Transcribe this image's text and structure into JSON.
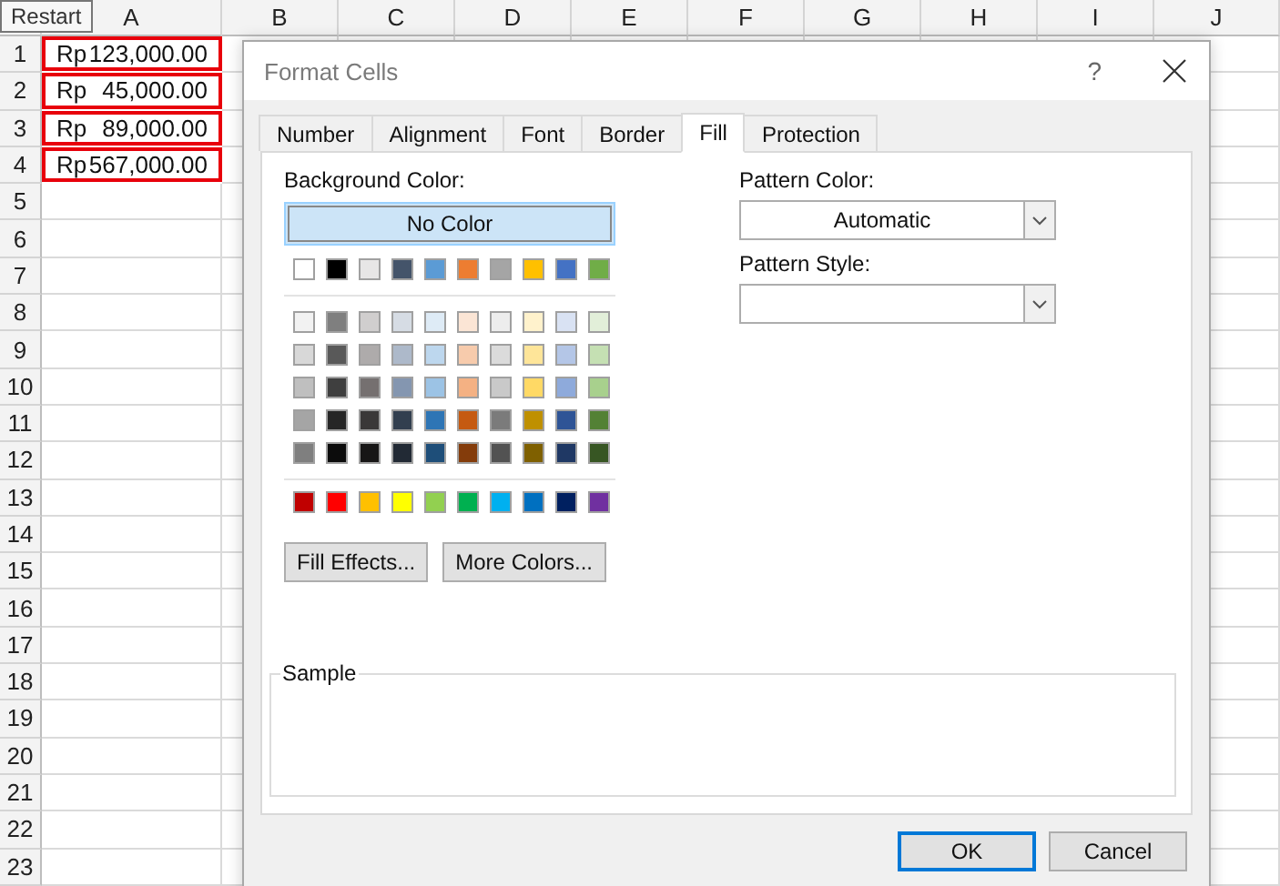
{
  "sheet": {
    "tooltip": "Restart",
    "columns": [
      "A",
      "B",
      "C",
      "D",
      "E",
      "F",
      "G",
      "H",
      "I",
      "J"
    ],
    "row_numbers": [
      "1",
      "2",
      "3",
      "4",
      "5",
      "6",
      "7",
      "8",
      "9",
      "10",
      "11",
      "12",
      "13",
      "14",
      "15",
      "16",
      "17",
      "18",
      "19",
      "20",
      "21",
      "22",
      "23"
    ],
    "cells": [
      {
        "currency": "Rp",
        "amount": "123,000.00",
        "outlined": true
      },
      {
        "currency": "Rp",
        "amount": "45,000.00",
        "outlined": true
      },
      {
        "currency": "Rp",
        "amount": "89,000.00",
        "outlined": true
      },
      {
        "currency": "Rp",
        "amount": "567,000.00",
        "outlined": true
      }
    ]
  },
  "dialog": {
    "title": "Format Cells",
    "help": "?",
    "tabs": [
      {
        "label": "Number",
        "selected": false
      },
      {
        "label": "Alignment",
        "selected": false
      },
      {
        "label": "Font",
        "selected": false
      },
      {
        "label": "Border",
        "selected": false
      },
      {
        "label": "Fill",
        "selected": true
      },
      {
        "label": "Protection",
        "selected": false
      }
    ],
    "background_color": {
      "label": "Background Color:",
      "no_color": {
        "label": "No Color",
        "selected": true
      },
      "theme_colors": [
        {
          "color": "#ffffff"
        },
        {
          "color": "#000000"
        },
        {
          "color": "#e7e6e6"
        },
        {
          "color": "#44546a"
        },
        {
          "color": "#5b9bd5"
        },
        {
          "color": "#ed7d31"
        },
        {
          "color": "#a5a5a5"
        },
        {
          "color": "#ffc000"
        },
        {
          "color": "#4472c4"
        },
        {
          "color": "#70ad47"
        }
      ],
      "tint_rows": [
        {
          "swatches": [
            {
              "color": "#f2f2f2"
            },
            {
              "color": "#7f7f7f"
            },
            {
              "color": "#d0cece"
            },
            {
              "color": "#d6dce4"
            },
            {
              "color": "#deebf6"
            },
            {
              "color": "#fbe5d5"
            },
            {
              "color": "#ededed"
            },
            {
              "color": "#fff2cc"
            },
            {
              "color": "#d9e2f3"
            },
            {
              "color": "#e2efd9"
            }
          ]
        },
        {
          "swatches": [
            {
              "color": "#d8d8d8"
            },
            {
              "color": "#595959"
            },
            {
              "color": "#aeabab"
            },
            {
              "color": "#adb9ca"
            },
            {
              "color": "#bdd7ee"
            },
            {
              "color": "#f7cbac"
            },
            {
              "color": "#dbdbdb"
            },
            {
              "color": "#fee599"
            },
            {
              "color": "#b4c6e7"
            },
            {
              "color": "#c5e0b3"
            }
          ]
        },
        {
          "swatches": [
            {
              "color": "#bfbfbf"
            },
            {
              "color": "#3f3f3f"
            },
            {
              "color": "#757070"
            },
            {
              "color": "#8496b0"
            },
            {
              "color": "#9cc3e5"
            },
            {
              "color": "#f4b183"
            },
            {
              "color": "#c9c9c9"
            },
            {
              "color": "#ffd965"
            },
            {
              "color": "#8eaadb"
            },
            {
              "color": "#a8d08d"
            }
          ]
        },
        {
          "swatches": [
            {
              "color": "#a5a5a5"
            },
            {
              "color": "#262626"
            },
            {
              "color": "#3a3838"
            },
            {
              "color": "#323f4f"
            },
            {
              "color": "#2e75b5"
            },
            {
              "color": "#c55a11"
            },
            {
              "color": "#7b7b7b"
            },
            {
              "color": "#bf9000"
            },
            {
              "color": "#2f5496"
            },
            {
              "color": "#538135"
            }
          ]
        },
        {
          "swatches": [
            {
              "color": "#7f7f7f"
            },
            {
              "color": "#0c0c0c"
            },
            {
              "color": "#171616"
            },
            {
              "color": "#222a35"
            },
            {
              "color": "#1e4e79"
            },
            {
              "color": "#843c0b"
            },
            {
              "color": "#525252"
            },
            {
              "color": "#7f6000"
            },
            {
              "color": "#1f3864"
            },
            {
              "color": "#375623"
            }
          ]
        }
      ],
      "standard_colors": [
        {
          "color": "#c00000"
        },
        {
          "color": "#ff0000"
        },
        {
          "color": "#ffc000"
        },
        {
          "color": "#ffff00"
        },
        {
          "color": "#92d050"
        },
        {
          "color": "#00b050"
        },
        {
          "color": "#00b0f0"
        },
        {
          "color": "#0070c0"
        },
        {
          "color": "#002060"
        },
        {
          "color": "#7030a0"
        }
      ]
    },
    "pattern_color": {
      "label": "Pattern Color:",
      "value": "Automatic"
    },
    "pattern_style": {
      "label": "Pattern Style:"
    },
    "fill_buttons": [
      {
        "label": "Fill Effects..."
      },
      {
        "label": "More Colors..."
      }
    ],
    "sample": {
      "label": "Sample"
    },
    "footer_buttons": [
      {
        "label": "OK",
        "default": true
      },
      {
        "label": "Cancel",
        "default": false
      }
    ]
  }
}
